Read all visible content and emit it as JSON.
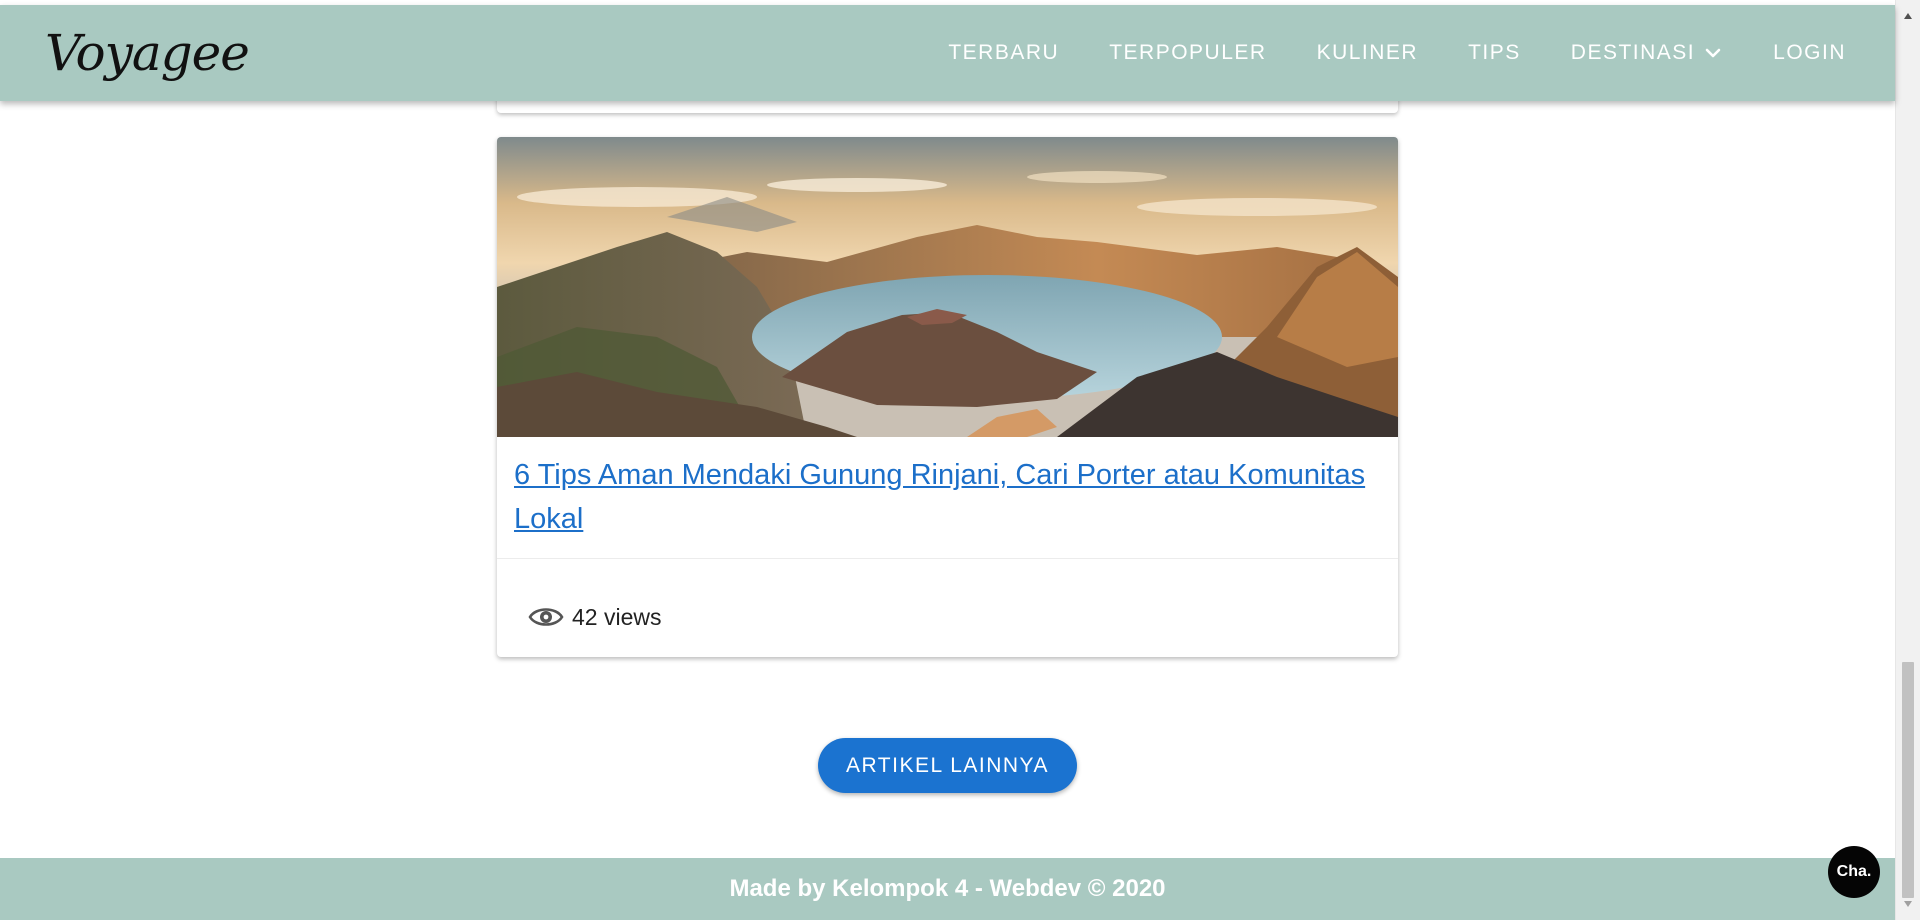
{
  "navbar": {
    "brand": "Voyagee",
    "items": [
      {
        "label": "TERBARU"
      },
      {
        "label": "TERPOPULER"
      },
      {
        "label": "KULINER"
      },
      {
        "label": "TIPS"
      },
      {
        "label": "DESTINASI",
        "icon": "chevron-down-icon"
      },
      {
        "label": "LOGIN"
      }
    ]
  },
  "article": {
    "title": "6 Tips Aman Mendaki Gunung Rinjani, Cari Porter atau Komunitas Lokal",
    "views": "42 views",
    "image_icon": "mountain-lake-photo"
  },
  "more_button": {
    "label": "ARTIKEL LAINNYA"
  },
  "footer": {
    "text": "Made by Kelompok 4 - Webdev © 2020"
  },
  "chat": {
    "label": "Cha."
  },
  "colors": {
    "header_footer": "#a9c9c1",
    "link": "#1c6fc9",
    "button": "#1b73d0",
    "chat_bubble": "#050505"
  }
}
